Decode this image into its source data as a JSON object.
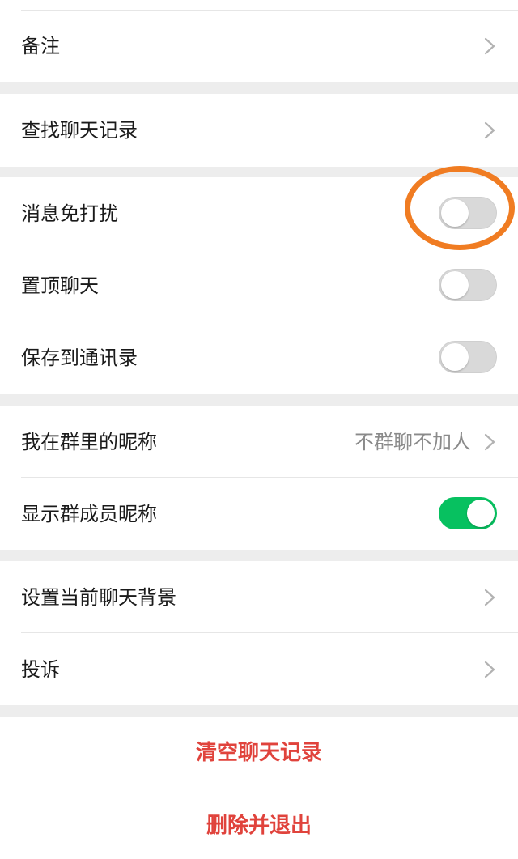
{
  "settings": {
    "remark": {
      "label": "备注"
    },
    "search_history": {
      "label": "查找聊天记录"
    },
    "mute": {
      "label": "消息免打扰",
      "enabled": false
    },
    "pin": {
      "label": "置顶聊天",
      "enabled": false
    },
    "save_contacts": {
      "label": "保存到通讯录",
      "enabled": false
    },
    "my_nickname": {
      "label": "我在群里的昵称",
      "value": "不群聊不加人"
    },
    "show_nicknames": {
      "label": "显示群成员昵称",
      "enabled": true
    },
    "background": {
      "label": "设置当前聊天背景"
    },
    "report": {
      "label": "投诉"
    }
  },
  "actions": {
    "clear_history": "清空聊天记录",
    "delete_exit": "删除并退出"
  },
  "colors": {
    "toggle_on": "#07c160",
    "toggle_off": "#d9d9d9",
    "danger_text": "#e0433c",
    "highlight": "#f07c22"
  }
}
